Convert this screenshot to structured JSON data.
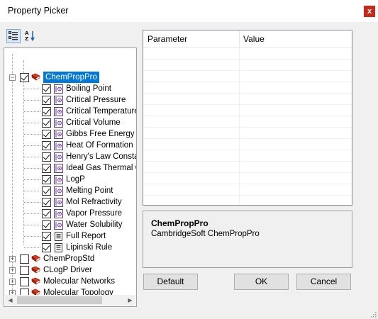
{
  "window": {
    "title": "Property Picker",
    "close_glyph": "x"
  },
  "toolbar": {
    "categorized_icon": "categorized-view-icon",
    "alphabetical_icon": "sort-alphabetical-icon"
  },
  "tree": {
    "root": {
      "label": "ChemPropPro",
      "checked": true,
      "expanded": true,
      "selected": true
    },
    "children": [
      {
        "label": "Boiling Point",
        "icon": "property-icon"
      },
      {
        "label": "Critical Pressure",
        "icon": "property-icon"
      },
      {
        "label": "Critical Temperature",
        "icon": "property-icon"
      },
      {
        "label": "Critical Volume",
        "icon": "property-icon"
      },
      {
        "label": "Gibbs Free Energy",
        "icon": "property-icon"
      },
      {
        "label": "Heat Of Formation",
        "icon": "property-icon"
      },
      {
        "label": "Henry's Law Constant",
        "icon": "property-icon"
      },
      {
        "label": "Ideal Gas Thermal Ca",
        "icon": "property-icon"
      },
      {
        "label": "LogP",
        "icon": "property-icon"
      },
      {
        "label": "Melting Point",
        "icon": "property-icon"
      },
      {
        "label": "Mol Refractivity",
        "icon": "property-icon"
      },
      {
        "label": "Vapor Pressure",
        "icon": "property-icon"
      },
      {
        "label": "Water Solubility",
        "icon": "property-icon"
      },
      {
        "label": "Full Report",
        "icon": "report-icon"
      },
      {
        "label": "Lipinski Rule",
        "icon": "report-icon"
      }
    ],
    "others": [
      {
        "label": "ChemPropStd"
      },
      {
        "label": "CLogP Driver"
      },
      {
        "label": "Molecular Networks"
      },
      {
        "label": "Molecular Topology"
      }
    ]
  },
  "grid": {
    "col_parameter": "Parameter",
    "col_value": "Value"
  },
  "description": {
    "name": "ChemPropPro",
    "text": "CambridgeSoft ChemPropPro"
  },
  "buttons": {
    "default": "Default",
    "ok": "OK",
    "cancel": "Cancel"
  },
  "colors": {
    "selection": "#0078d7",
    "close": "#c42b1c",
    "book_red": "#cc2200",
    "property_purple": "#6a1b9a"
  }
}
